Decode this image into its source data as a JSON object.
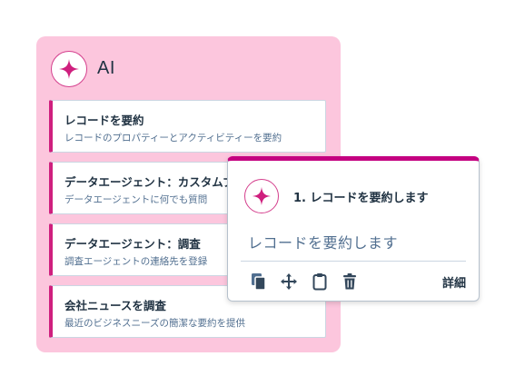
{
  "panel": {
    "title": "AI",
    "icon": "sparkle-icon",
    "items": [
      {
        "title": "レコードを要約",
        "desc": "レコードのプロパティーとアクティビティーを要約"
      },
      {
        "title": "データエージェント：カスタムプ",
        "desc": "データエージェントに何でも質問"
      },
      {
        "title": "データエージェント：調査",
        "desc": "調査エージェントの連絡先を登録"
      },
      {
        "title": "会社ニュースを調査",
        "desc": "最近のビジネスニーズの簡潔な要約を提供"
      }
    ]
  },
  "popup": {
    "title": "1. レコードを要約します",
    "body": "レコードを要約します",
    "details_label": "詳細",
    "tools": [
      "copy-icon",
      "move-icon",
      "clipboard-icon",
      "trash-icon"
    ]
  },
  "colors": {
    "accent": "#cf1f7e",
    "panel_bg": "#fcc6dd",
    "text": "#213343"
  }
}
